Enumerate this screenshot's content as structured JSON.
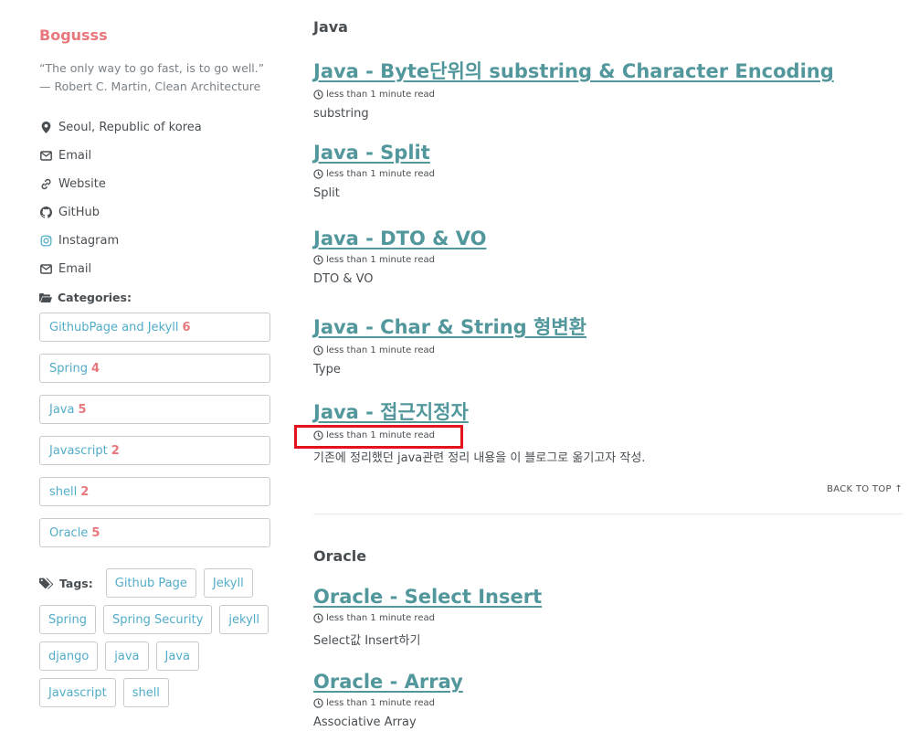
{
  "author": {
    "name": "Bogusss",
    "bio": "“The only way to go fast, is to go well.” — Robert C. Martin, Clean Architecture"
  },
  "links": [
    {
      "icon": "map-marker-icon",
      "label": "Seoul, Republic of korea"
    },
    {
      "icon": "envelope-icon",
      "label": "Email"
    },
    {
      "icon": "link-icon",
      "label": "Website"
    },
    {
      "icon": "github-icon",
      "label": "GitHub"
    },
    {
      "icon": "instagram-icon",
      "label": "Instagram"
    },
    {
      "icon": "envelope-icon",
      "label": "Email"
    }
  ],
  "categories": {
    "heading": "Categories:",
    "items": [
      {
        "name": "GithubPage and Jekyll",
        "count": "6"
      },
      {
        "name": "Spring",
        "count": "4"
      },
      {
        "name": "Java",
        "count": "5"
      },
      {
        "name": "Javascript",
        "count": "2"
      },
      {
        "name": "shell",
        "count": "2"
      },
      {
        "name": "Oracle",
        "count": "5"
      }
    ]
  },
  "tags": {
    "heading": "Tags:",
    "items": [
      "Github Page",
      "Jekyll",
      "Spring",
      "Spring Security",
      "jekyll",
      "django",
      "java",
      "Java",
      "Javascript",
      "shell"
    ]
  },
  "sections": [
    {
      "title": "Java",
      "posts": [
        {
          "title": "Java - Byte단위의 substring & Character Encoding",
          "meta": "less than 1 minute read",
          "excerpt": "substring"
        },
        {
          "title": "Java - Split",
          "meta": "less than 1 minute read",
          "excerpt": "Split"
        },
        {
          "title": "Java - DTO & VO",
          "meta": "less than 1 minute read",
          "excerpt": "DTO & VO"
        },
        {
          "title": "Java - Char & String 형변환",
          "meta": "less than 1 minute read",
          "excerpt": "Type"
        },
        {
          "title": "Java - 접근지정자",
          "meta": "less than 1 minute read",
          "excerpt": " 기존에 정리했던 java관련 정리 내용을 이 블로그로 옮기고자 작성."
        }
      ]
    },
    {
      "title": "Oracle",
      "posts": [
        {
          "title": "Oracle - Select Insert",
          "meta": "less than 1 minute read",
          "excerpt": "Select값 Insert하기"
        },
        {
          "title": "Oracle - Array",
          "meta": "less than 1 minute read",
          "excerpt": "Associative Array"
        }
      ]
    }
  ],
  "back_to_top": "BACK TO TOP ↑",
  "colors": {
    "accent": "#e8787d",
    "link": "#52979c",
    "tag_text": "#52adc8",
    "highlight": "#e3131b"
  }
}
